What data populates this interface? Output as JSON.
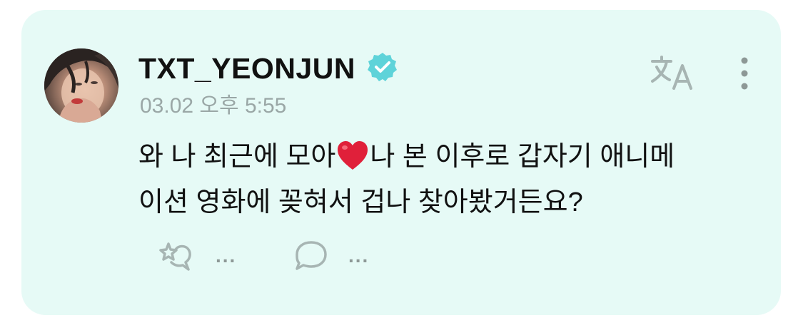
{
  "post": {
    "username": "TXT_YEONJUN",
    "timestamp": "03.02 오후 5:55",
    "text_line1_before": "와 나 최근에 모아",
    "text_line1_after": "나 본 이후로 갑자기 애니메",
    "text_line2": "이션 영화에 꽂혀서 겁나 찾아봤거든요?",
    "inline_emoji": "heart-emoji"
  },
  "actions": {
    "like_count": "...",
    "comment_count": "..."
  },
  "icons": {
    "verified": "verified-badge-icon",
    "translate": "translate-icon",
    "more": "more-vertical-icon",
    "like": "sparkle-heart-icon",
    "comment": "comment-bubble-icon"
  },
  "colors": {
    "card_background": "#e6faf6",
    "verified_badge": "#5ed3d9",
    "muted": "#9aa7a6",
    "heart": "#e0203a"
  }
}
